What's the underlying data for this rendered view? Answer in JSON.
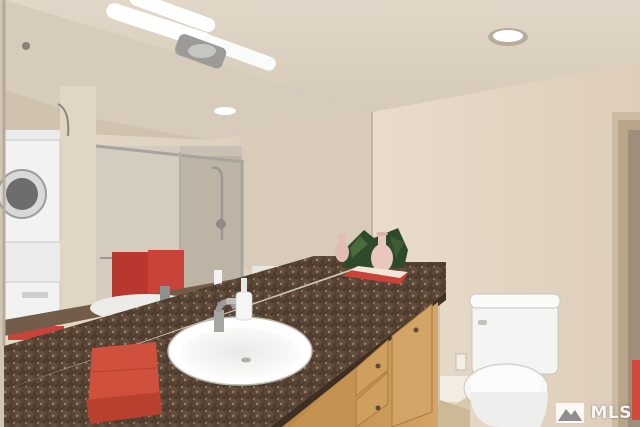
{
  "watermark": {
    "text": "MLS",
    "icon": "mountain-logo-icon"
  },
  "colors": {
    "wall": "#e6d8c7",
    "ceiling": "#dfd4c4",
    "granite": "#5a4636",
    "cabinet": "#c99a5a",
    "towel": "#c9463a",
    "toilet": "#f2f2f0"
  }
}
